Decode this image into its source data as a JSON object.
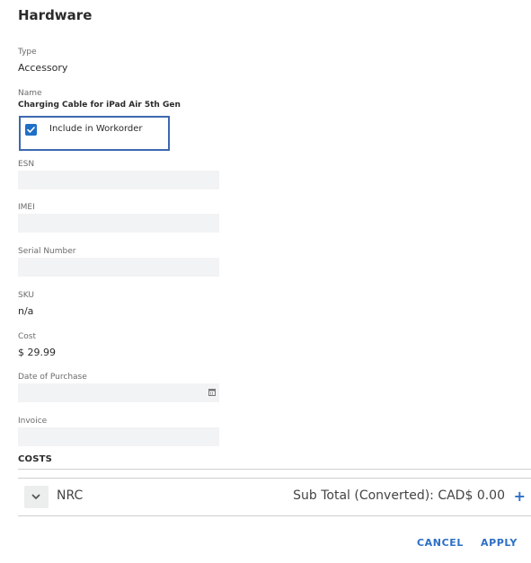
{
  "header": {
    "title": "Hardware"
  },
  "fields": {
    "type": {
      "label": "Type",
      "value": "Accessory"
    },
    "name": {
      "label": "Name",
      "value": "Charging Cable for iPad Air 5th Gen"
    },
    "include_in_workorder": {
      "label": "Include in Workorder",
      "checked": true
    },
    "esn": {
      "label": "ESN",
      "value": ""
    },
    "imei": {
      "label": "IMEI",
      "value": ""
    },
    "serial_number": {
      "label": "Serial Number",
      "value": ""
    },
    "sku": {
      "label": "SKU",
      "value": "n/a"
    },
    "cost": {
      "label": "Cost",
      "value": "$ 29.99"
    },
    "date_of_purchase": {
      "label": "Date of Purchase",
      "value": ""
    },
    "invoice": {
      "label": "Invoice",
      "value": ""
    }
  },
  "costs": {
    "heading": "COSTS",
    "row": {
      "name": "NRC",
      "subtotal": "Sub Total (Converted): CAD$ 0.00"
    }
  },
  "footer": {
    "cancel_label": "CANCEL",
    "apply_label": "APPLY"
  },
  "colors": {
    "accent": "#2c6fc6",
    "focus_border": "#3d68b1",
    "input_bg": "#f2f3f4"
  },
  "icons": {
    "checkbox": "checkmark-icon",
    "date": "calendar-icon",
    "expand": "chevron-down-icon",
    "add": "plus-icon"
  }
}
